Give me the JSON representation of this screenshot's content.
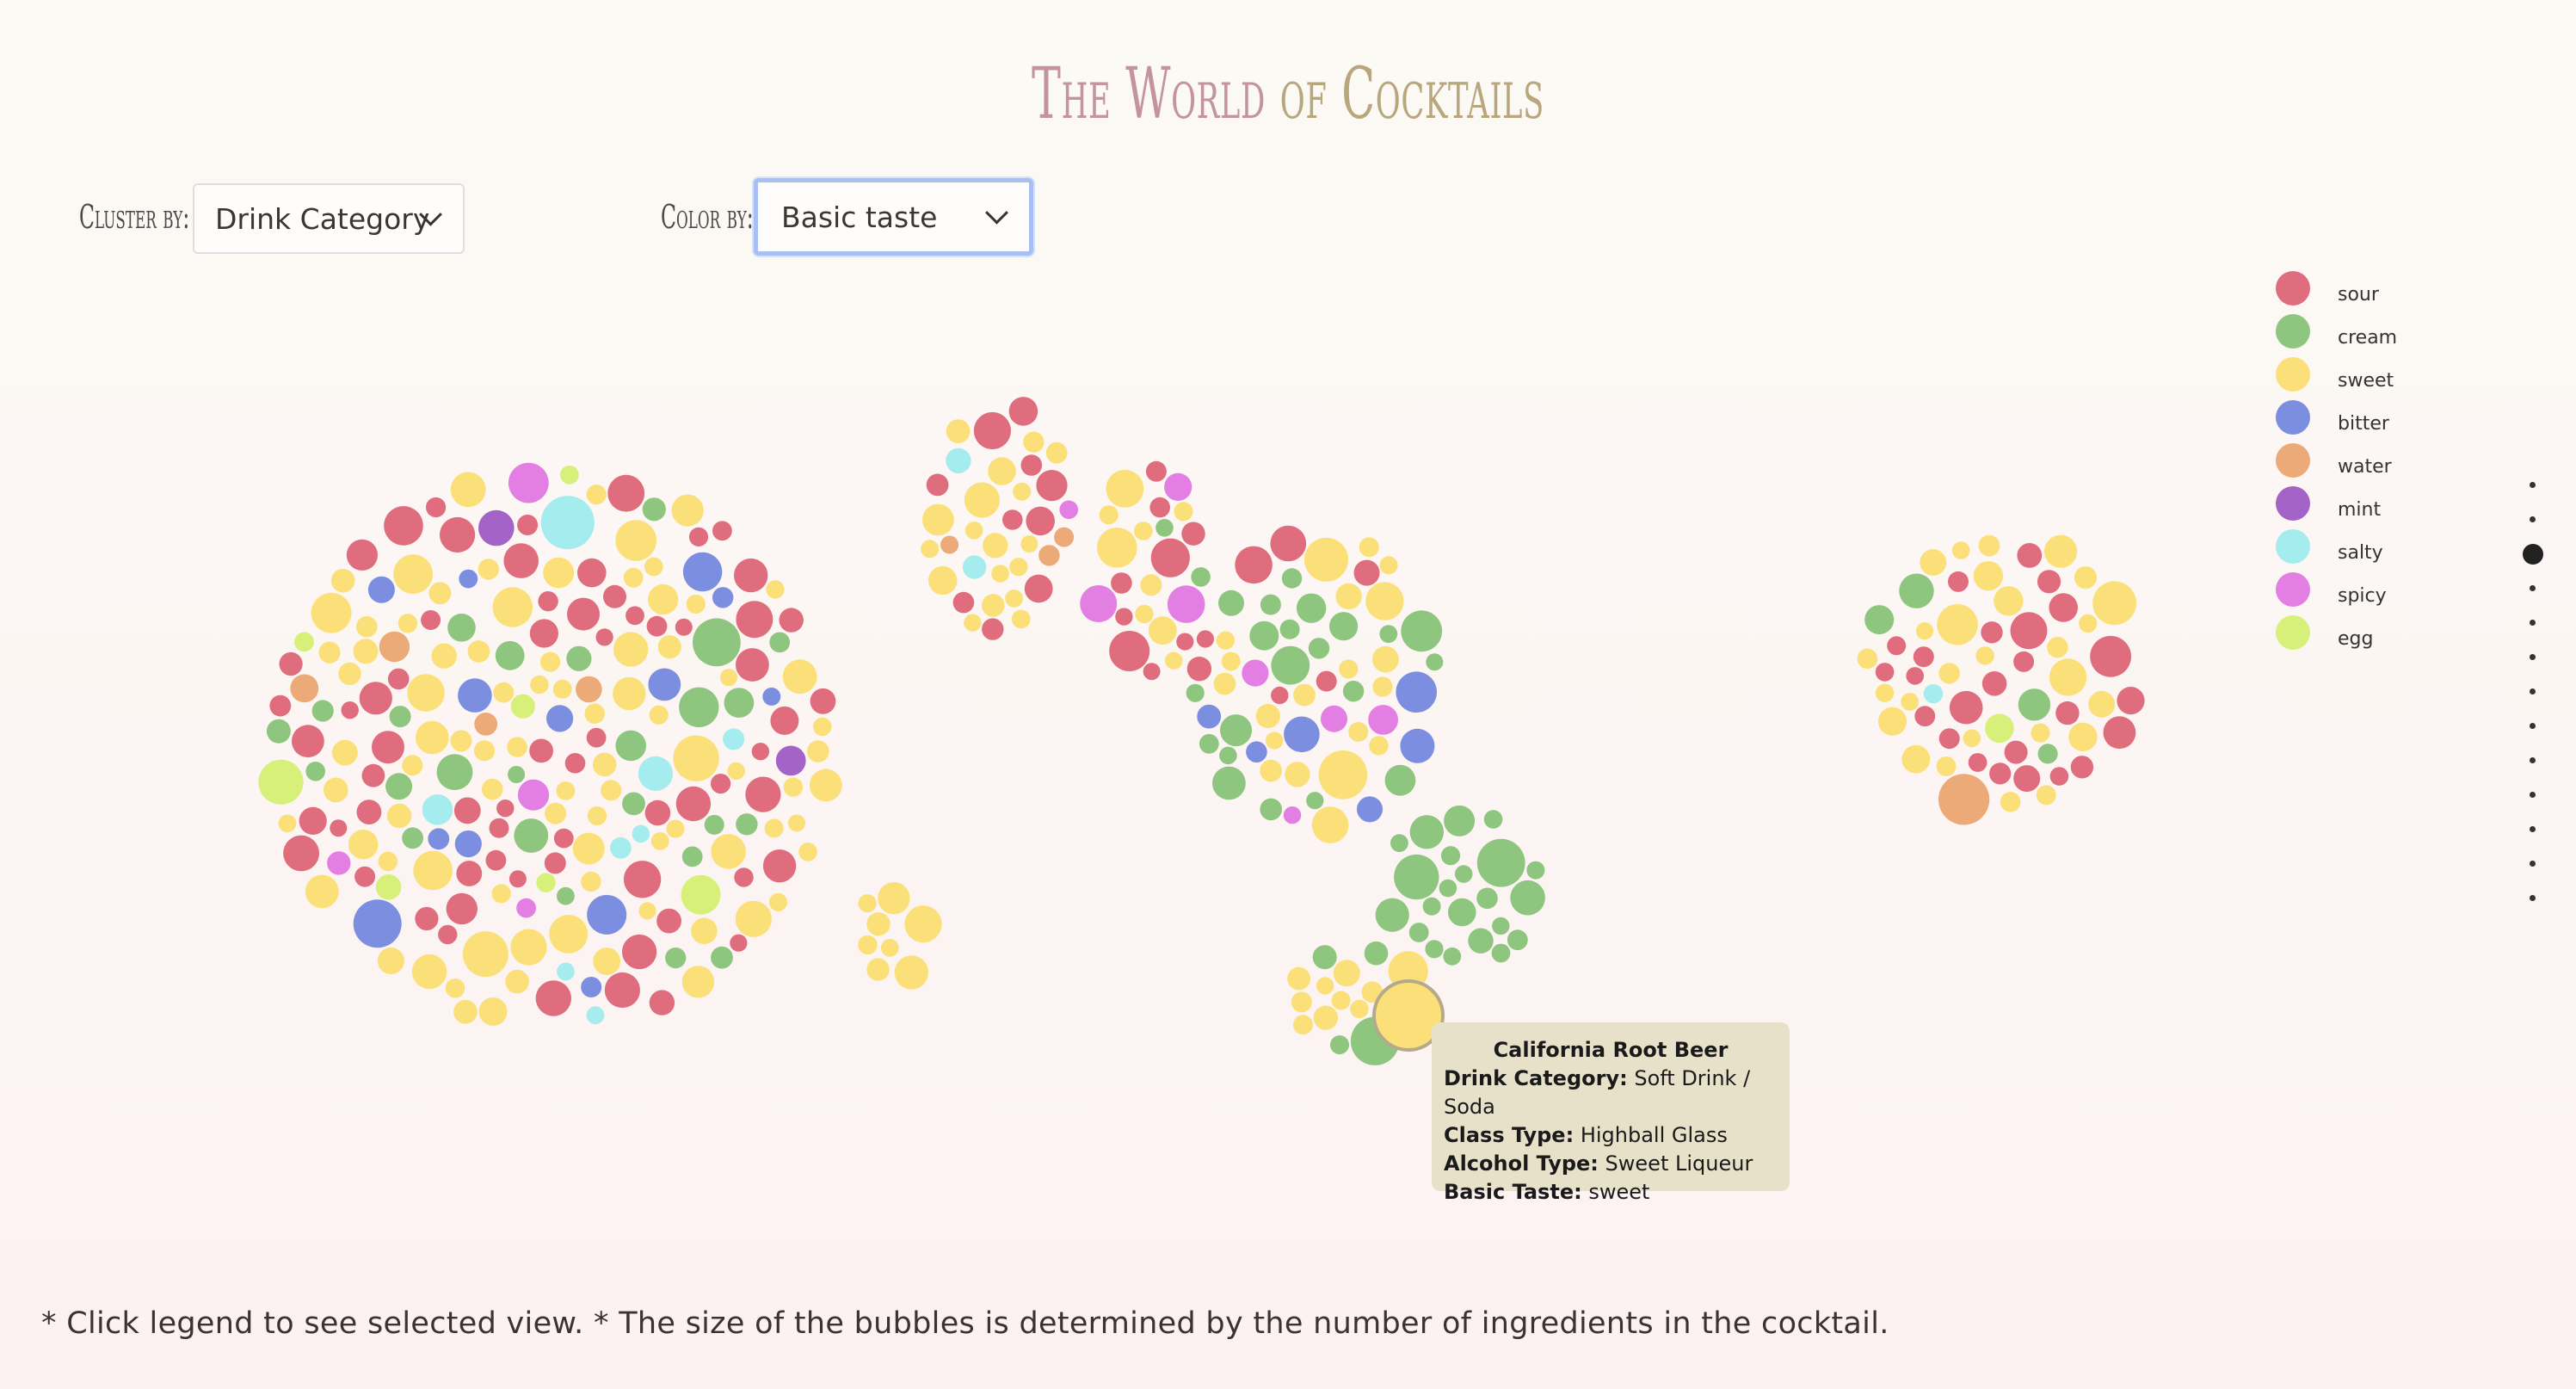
{
  "header": {
    "title_part1": "The World ",
    "title_part2": "of Cocktails"
  },
  "controls": {
    "cluster_label": "Cluster by:",
    "cluster_value": "Drink Category",
    "color_label": "Color by:",
    "color_value": "Basic taste"
  },
  "legend": [
    {
      "label": "sour",
      "color": "#e06d7e"
    },
    {
      "label": "cream",
      "color": "#8ec57f"
    },
    {
      "label": "sweet",
      "color": "#fbe07a"
    },
    {
      "label": "bitter",
      "color": "#7b8ee0"
    },
    {
      "label": "water",
      "color": "#ecaa78"
    },
    {
      "label": "mint",
      "color": "#a363c7"
    },
    {
      "label": "salty",
      "color": "#a4ecee"
    },
    {
      "label": "spicy",
      "color": "#e37fe3"
    },
    {
      "label": "egg",
      "color": "#d6f07a"
    }
  ],
  "tooltip": {
    "title": "California Root Beer",
    "category_label": "Drink Category:",
    "category_value": "Soft Drink / Soda",
    "class_label": "Class Type:",
    "class_value": "Highball Glass",
    "alcohol_label": "Alcohol Type:",
    "alcohol_value": "Sweet Liqueur",
    "taste_label": "Basic Taste:",
    "taste_value": "sweet"
  },
  "footnote": "* Click legend to see selected view. * The size of the bubbles is determined by the number of ingredients in the cocktail.",
  "pager": {
    "count": 13,
    "active_index": 2
  }
}
